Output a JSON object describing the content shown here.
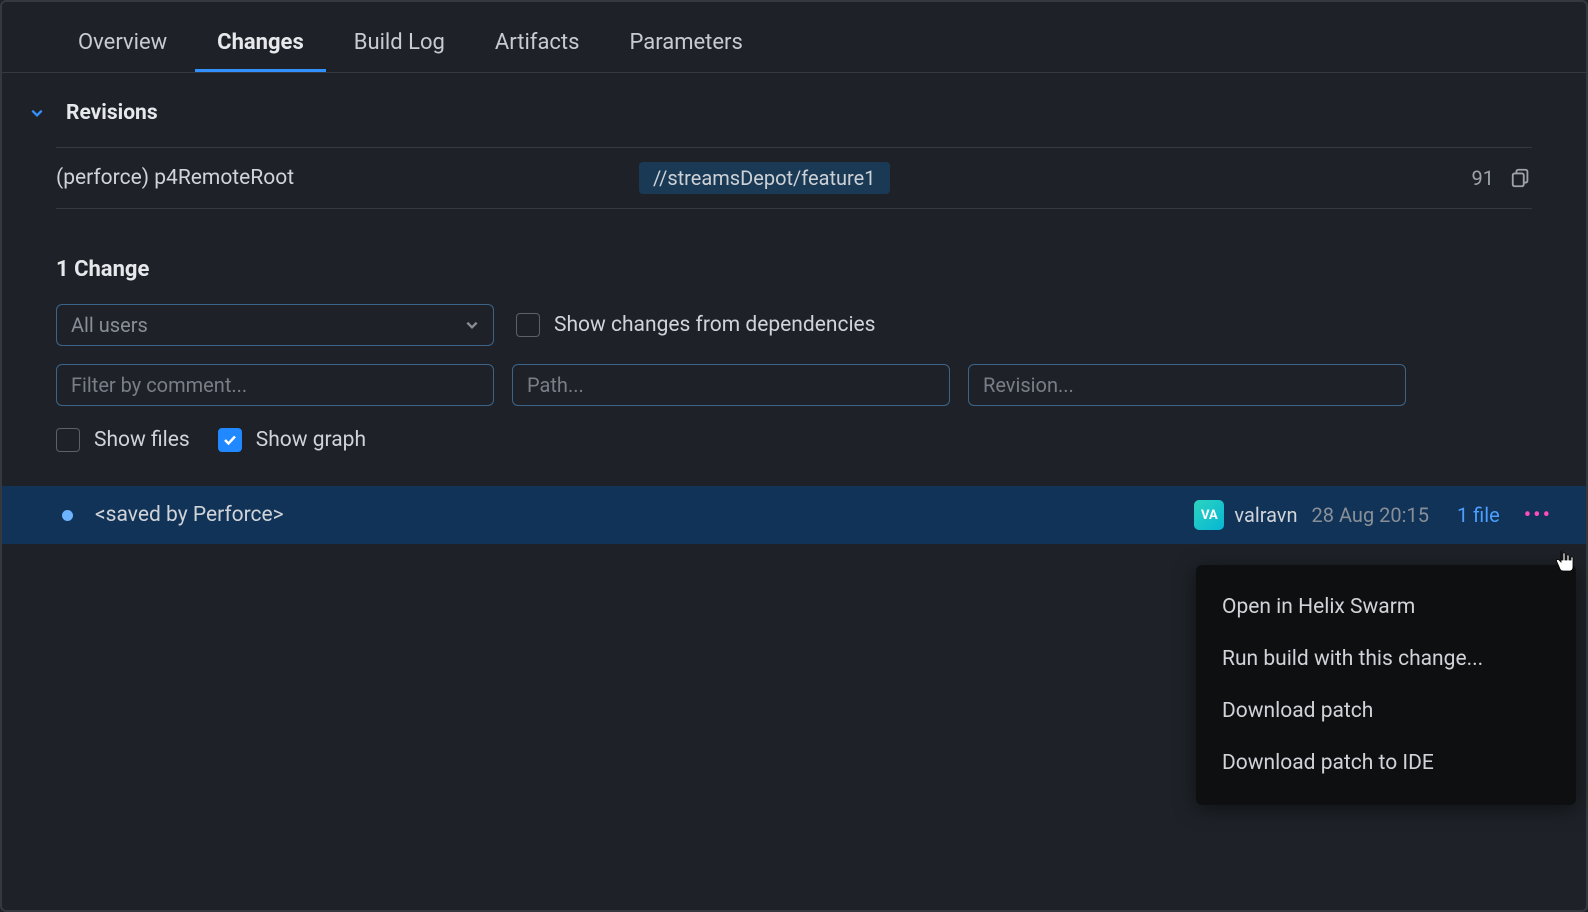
{
  "tabs": {
    "overview": "Overview",
    "changes": "Changes",
    "buildlog": "Build Log",
    "artifacts": "Artifacts",
    "parameters": "Parameters"
  },
  "revisions": {
    "title": "Revisions",
    "vcs_label": "(perforce) p4RemoteRoot",
    "stream": "//streamsDepot/feature1",
    "count": "91"
  },
  "changes": {
    "title": "1 Change",
    "users_select": "All users",
    "dependencies_label": "Show changes from dependencies",
    "comment_placeholder": "Filter by comment...",
    "path_placeholder": "Path...",
    "revision_placeholder": "Revision...",
    "show_files_label": "Show files",
    "show_graph_label": "Show graph"
  },
  "change_row": {
    "message": "<saved by Perforce>",
    "avatar_initials": "VA",
    "username": "valravn",
    "timestamp": "28 Aug 20:15",
    "files": "1 file"
  },
  "context_menu": {
    "items": [
      "Open in Helix Swarm",
      "Run build with this change...",
      "Download patch",
      "Download patch to IDE"
    ]
  }
}
